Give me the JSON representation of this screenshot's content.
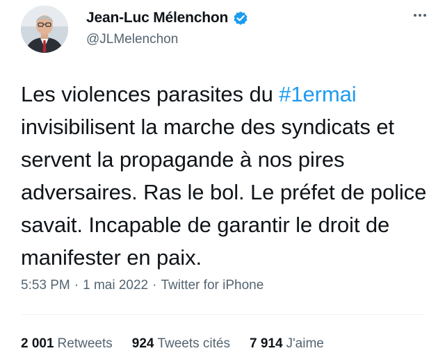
{
  "author": {
    "display_name": "Jean-Luc Mélenchon",
    "handle": "@JLMelenchon",
    "verified": true
  },
  "tweet": {
    "text_before": "Les violences parasites du ",
    "hashtag": "#1ermai",
    "text_after": " invisibilisent la marche des syndicats et servent la propagande à nos pires adversaires. Ras le bol. Le préfet de police savait. Incapable de garantir le droit de manifester en paix."
  },
  "meta": {
    "time": "5:53 PM",
    "separator": "·",
    "date": "1 mai 2022",
    "source": "Twitter for iPhone"
  },
  "stats": {
    "retweets_count": "2 001",
    "retweets_label": "Retweets",
    "quotes_count": "924",
    "quotes_label": "Tweets cités",
    "likes_count": "7 914",
    "likes_label": "J'aime"
  },
  "colors": {
    "accent": "#1d9bf0",
    "text": "#0f1419",
    "secondary": "#536471",
    "divider": "#eff3f4"
  },
  "icons": {
    "verified": "verified-badge-icon",
    "more": "more-options-icon"
  }
}
